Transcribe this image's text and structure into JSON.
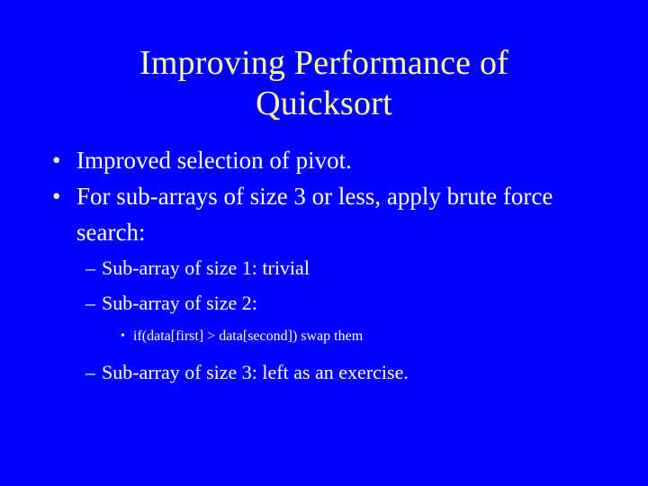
{
  "slide": {
    "background_color": "#0000FF",
    "title_color": "#FFFF99",
    "body_color": "#FFFFFF",
    "title": {
      "line1": "Improving Performance of",
      "line2": "Quicksort"
    },
    "markers": {
      "level1": "•",
      "level2": "–",
      "level3": "•"
    },
    "bullets": [
      {
        "level": 1,
        "text": "Improved selection of pivot."
      },
      {
        "level": 1,
        "text": "For sub-arrays of size 3 or less, apply brute force search:"
      },
      {
        "level": 2,
        "text": "Sub-array of size 1: trivial"
      },
      {
        "level": 2,
        "text": "Sub-array of size 2:"
      },
      {
        "level": 3,
        "text": "if(data[first] > data[second]) swap them"
      },
      {
        "level": 2,
        "text": "Sub-array of size 3: left as an exercise."
      }
    ]
  }
}
